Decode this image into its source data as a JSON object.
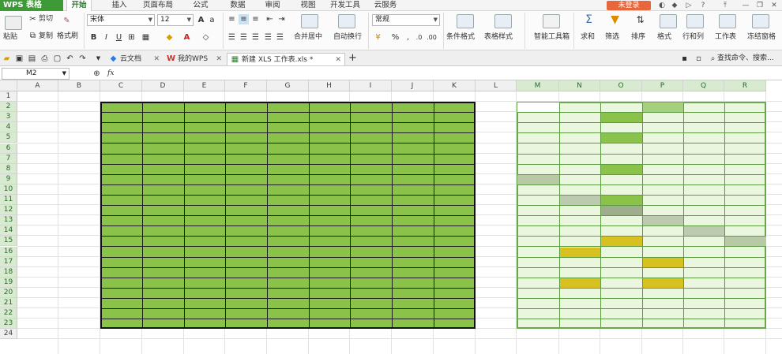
{
  "app": {
    "logo": "WPS 表格",
    "login": "未登录"
  },
  "menu": [
    {
      "label": "开始",
      "active": true
    },
    {
      "label": "插入"
    },
    {
      "label": "页面布局"
    },
    {
      "label": "公式"
    },
    {
      "label": "数据"
    },
    {
      "label": "审阅"
    },
    {
      "label": "视图"
    },
    {
      "label": "开发工具"
    },
    {
      "label": "云服务"
    }
  ],
  "ribbon": {
    "paste": "粘贴",
    "cut": "剪切",
    "copy": "复制",
    "format_painter": "格式刷",
    "font_name": "宋体",
    "font_size": "12",
    "bold": "B",
    "italic": "I",
    "underline": "U",
    "merge_center": "合并居中",
    "wrap_text": "自动换行",
    "number_format": "常规",
    "percent": "%",
    "comma": ",",
    "conditional_format": "条件格式",
    "table_style": "表格样式",
    "smart_toolbox": "智能工具箱",
    "sum": "求和",
    "filter": "筛选",
    "sort": "排序",
    "format": "格式",
    "row_col": "行和列",
    "worksheet": "工作表",
    "freeze": "冻结窗格"
  },
  "tabs": [
    {
      "label": "云文档"
    },
    {
      "label": "我的WPS"
    },
    {
      "label": "新建 XLS 工作表.xls *",
      "active": true
    }
  ],
  "search": {
    "placeholder": "查找命令、搜索..."
  },
  "formula": {
    "name_box": "M2",
    "fx": "fx",
    "value": ""
  },
  "sheet": {
    "columns": [
      "A",
      "B",
      "C",
      "D",
      "E",
      "F",
      "G",
      "H",
      "I",
      "J",
      "K",
      "L",
      "M",
      "N",
      "O",
      "P",
      "Q",
      "R"
    ],
    "rows": [
      "1",
      "2",
      "3",
      "4",
      "5",
      "6",
      "7",
      "8",
      "9",
      "10",
      "11",
      "12",
      "13",
      "14",
      "15",
      "16",
      "17",
      "18",
      "19",
      "20",
      "21",
      "22",
      "23",
      "24"
    ],
    "active_cell": "M2",
    "green_block": {
      "range": "C2:K23",
      "fill": "#8bc34a"
    },
    "right_block": {
      "range": "M2:R23",
      "fill": "#eaf6dd",
      "border": "#6aa84f"
    },
    "highlights": [
      {
        "cell": "M2",
        "color": "#ffffff"
      },
      {
        "cell": "P2",
        "color": "#a5d17e"
      },
      {
        "cell": "O3",
        "color": "#8bc34a"
      },
      {
        "cell": "O5",
        "color": "#8bc34a"
      },
      {
        "cell": "O8",
        "color": "#8bc34a"
      },
      {
        "cell": "M9",
        "color": "#b8c9a6"
      },
      {
        "cell": "N11",
        "color": "#bccab0"
      },
      {
        "cell": "O11",
        "color": "#8bc34a"
      },
      {
        "cell": "O12",
        "color": "#9eae8c"
      },
      {
        "cell": "P13",
        "color": "#bccab0"
      },
      {
        "cell": "Q14",
        "color": "#bccab0"
      },
      {
        "cell": "O15",
        "color": "#d8c020"
      },
      {
        "cell": "R15",
        "color": "#b8c9a6"
      },
      {
        "cell": "N16",
        "color": "#d8c020"
      },
      {
        "cell": "P17",
        "color": "#d8c020"
      },
      {
        "cell": "N19",
        "color": "#d8c020"
      },
      {
        "cell": "P19",
        "color": "#d8c020"
      }
    ]
  }
}
